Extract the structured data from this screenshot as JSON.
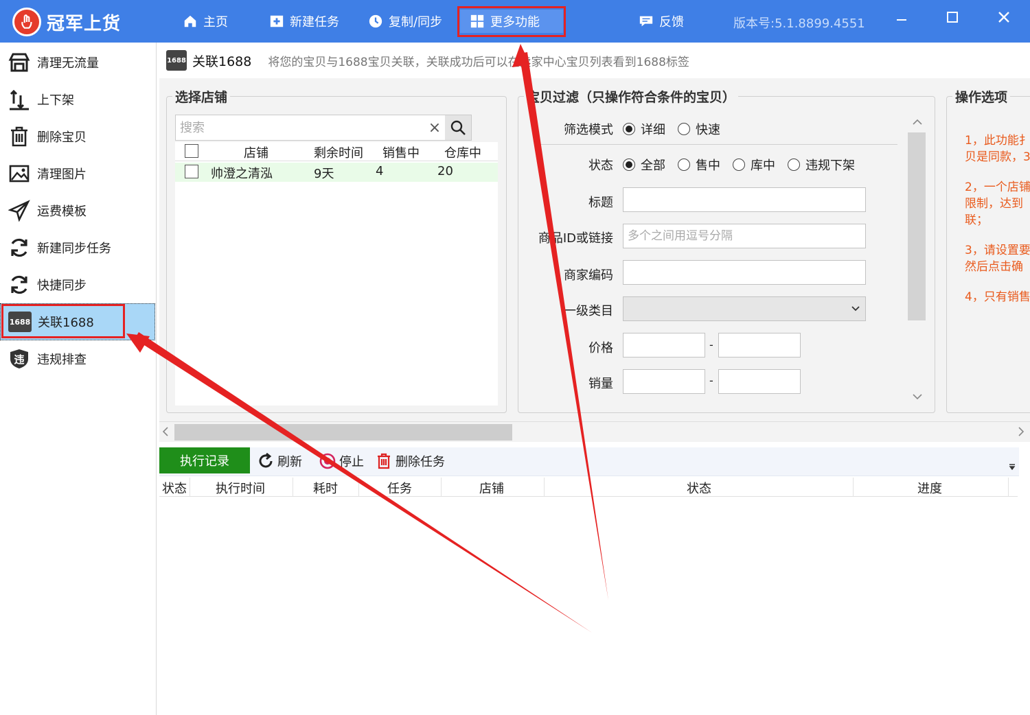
{
  "app": {
    "title": "冠军上货",
    "version": "版本号:5.1.8899.4551"
  },
  "nav": [
    {
      "label": "主页",
      "icon": "home-icon"
    },
    {
      "label": "新建任务",
      "icon": "plus-doc-icon"
    },
    {
      "label": "复制/同步",
      "icon": "clock-icon"
    },
    {
      "label": "更多功能",
      "icon": "grid-icon",
      "active": true
    },
    {
      "label": "反馈",
      "icon": "feedback-icon"
    }
  ],
  "window_controls": [
    "minimize",
    "maximize",
    "close"
  ],
  "sidebar": {
    "items": [
      {
        "label": "清理无流量",
        "icon": "store-icon"
      },
      {
        "label": "上下架",
        "icon": "shelf-icon"
      },
      {
        "label": "删除宝贝",
        "icon": "trash-icon"
      },
      {
        "label": "清理图片",
        "icon": "image-icon"
      },
      {
        "label": "运费模板",
        "icon": "send-icon"
      },
      {
        "label": "新建同步任务",
        "icon": "sync-icon"
      },
      {
        "label": "快捷同步",
        "icon": "sync-icon"
      },
      {
        "label": "关联1688",
        "icon": "badge-1688-icon",
        "badge": "1688",
        "active": true
      },
      {
        "label": "违规排查",
        "icon": "shield-icon",
        "glyph": "违"
      }
    ]
  },
  "header": {
    "badge": "1688",
    "title": "关联1688",
    "description": "将您的宝贝与1688宝贝关联，关联成功后可以在卖家中心宝贝列表看到1688标签"
  },
  "shop_panel": {
    "title": "选择店铺",
    "search_placeholder": "搜索",
    "columns": [
      "店铺",
      "剩余时间",
      "销售中",
      "仓库中"
    ],
    "rows": [
      {
        "shop": "帅澄之清泓",
        "remaining": "9天",
        "on_sale": "4",
        "in_stock": "20"
      }
    ]
  },
  "filter_panel": {
    "title": "宝贝过滤（只操作符合条件的宝贝）",
    "mode_label": "筛选模式",
    "mode_options": [
      "详细",
      "快速"
    ],
    "mode_selected": "详细",
    "status_label": "状态",
    "status_options": [
      "全部",
      "售中",
      "库中",
      "违规下架"
    ],
    "status_selected": "全部",
    "title_label": "标题",
    "id_label": "商品ID或链接",
    "id_placeholder": "多个之间用逗号分隔",
    "code_label": "商家编码",
    "category_label": "一级类目",
    "price_label": "价格",
    "sales_label": "销量",
    "range_sep": "-"
  },
  "ops_panel": {
    "title": "操作选项",
    "notes": [
      "1，此功能扌",
      "贝是同款，3",
      "2，一个店铺",
      "限制，达到",
      "联；",
      "3，请设置要",
      "然后点击确",
      "4，只有销售"
    ]
  },
  "toolbar": {
    "log_label": "执行记录",
    "refresh_label": "刷新",
    "stop_label": "停止",
    "delete_label": "删除任务"
  },
  "log_table": {
    "columns": [
      "状态",
      "执行时间",
      "耗时",
      "任务",
      "店铺",
      "状态",
      "进度"
    ]
  },
  "colors": {
    "titlebar": "#3f7fe6",
    "accent_red": "#e52222",
    "log_button": "#1f8e1a",
    "notes_text": "#e95a1c"
  }
}
